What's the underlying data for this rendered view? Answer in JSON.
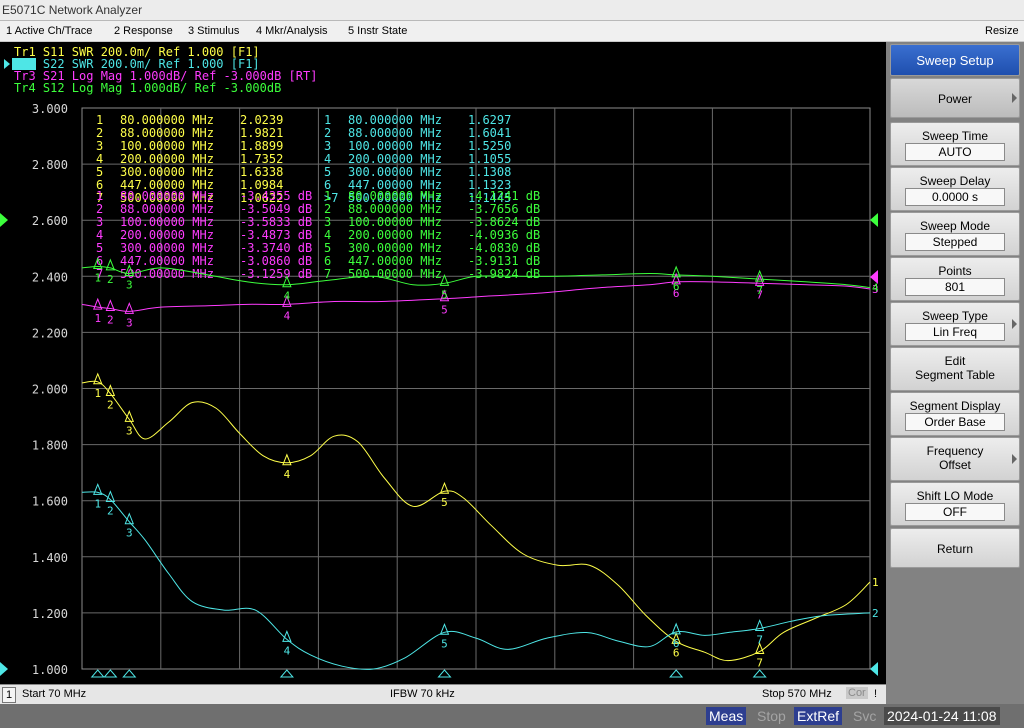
{
  "window": {
    "title": "E5071C Network Analyzer",
    "resize_label": "Resize"
  },
  "menu": [
    "1 Active Ch/Trace",
    "2 Response",
    "3 Stimulus",
    "4 Mkr/Analysis",
    "5 Instr State"
  ],
  "traces": [
    {
      "label": "Tr1 S11 SWR 200.0m/ Ref 1.000 [F1]",
      "color": "#ffff4a"
    },
    {
      "label": "Tr2 S22 SWR 200.0m/ Ref 1.000 [F1]",
      "color": "#4ee6e6"
    },
    {
      "label": "Tr3 S21 Log Mag 1.000dB/ Ref -3.000dB [RT]",
      "color": "#ff3cff"
    },
    {
      "label": "Tr4 S12 Log Mag 1.000dB/ Ref -3.000dB",
      "color": "#3cff3c"
    }
  ],
  "axis": {
    "y_ticks": [
      "3.000",
      "2.800",
      "2.600",
      "2.400",
      "2.200",
      "2.000",
      "1.800",
      "1.600",
      "1.400",
      "1.200",
      "1.000"
    ],
    "ylim": [
      1.0,
      3.0
    ],
    "xlim_mhz": [
      70,
      570
    ]
  },
  "marker_tables": {
    "tr1": [
      {
        "n": "1",
        "freq": "80.000000 MHz",
        "val": "2.0239"
      },
      {
        "n": "2",
        "freq": "88.000000 MHz",
        "val": "1.9821"
      },
      {
        "n": "3",
        "freq": "100.00000 MHz",
        "val": "1.8899"
      },
      {
        "n": "4",
        "freq": "200.00000 MHz",
        "val": "1.7352"
      },
      {
        "n": "5",
        "freq": "300.00000 MHz",
        "val": "1.6338"
      },
      {
        "n": "6",
        "freq": "447.00000 MHz",
        "val": "1.0984"
      },
      {
        "n": "7",
        "freq": "500.00000 MHz",
        "val": "1.0622"
      }
    ],
    "tr2": [
      {
        "n": "1",
        "freq": "80.000000 MHz",
        "val": "1.6297"
      },
      {
        "n": "2",
        "freq": "88.000000 MHz",
        "val": "1.6041"
      },
      {
        "n": "3",
        "freq": "100.00000 MHz",
        "val": "1.5250"
      },
      {
        "n": "4",
        "freq": "200.00000 MHz",
        "val": "1.1055"
      },
      {
        "n": "5",
        "freq": "300.00000 MHz",
        "val": "1.1308"
      },
      {
        "n": "6",
        "freq": "447.00000 MHz",
        "val": "1.1323"
      },
      {
        "n": ">7",
        "freq": "500.00000 MHz",
        "val": "1.1445"
      }
    ],
    "tr3": [
      {
        "n": "1",
        "freq": "80.000000 MHz",
        "val": "-3.4355 dB"
      },
      {
        "n": "2",
        "freq": "88.000000 MHz",
        "val": "-3.5049 dB"
      },
      {
        "n": "3",
        "freq": "100.00000 MHz",
        "val": "-3.5833 dB"
      },
      {
        "n": "4",
        "freq": "200.00000 MHz",
        "val": "-3.4873 dB"
      },
      {
        "n": "5",
        "freq": "300.00000 MHz",
        "val": "-3.3740 dB"
      },
      {
        "n": "6",
        "freq": "447.00000 MHz",
        "val": "-3.0860 dB"
      },
      {
        "n": "7",
        "freq": "500.00000 MHz",
        "val": "-3.1259 dB"
      }
    ],
    "tr4": [
      {
        "n": "1",
        "freq": "80.000000 MHz",
        "val": "-4.1241 dB"
      },
      {
        "n": "2",
        "freq": "88.000000 MHz",
        "val": "-3.7656 dB"
      },
      {
        "n": "3",
        "freq": "100.00000 MHz",
        "val": "-3.8624 dB"
      },
      {
        "n": "4",
        "freq": "200.00000 MHz",
        "val": "-4.0936 dB"
      },
      {
        "n": "5",
        "freq": "300.00000 MHz",
        "val": "-4.0830 dB"
      },
      {
        "n": "6",
        "freq": "447.00000 MHz",
        "val": "-3.9131 dB"
      },
      {
        "n": "7",
        "freq": "500.00000 MHz",
        "val": "-3.9824 dB"
      }
    ]
  },
  "chart_data": {
    "type": "line",
    "ylim": [
      1.0,
      3.0
    ],
    "xlim": [
      70,
      570
    ],
    "series": [
      {
        "name": "Tr1 S11",
        "color": "#ffff4a",
        "points": [
          [
            70,
            2.02
          ],
          [
            80,
            2.0239
          ],
          [
            88,
            1.9821
          ],
          [
            100,
            1.8899
          ],
          [
            110,
            1.82
          ],
          [
            125,
            1.88
          ],
          [
            140,
            1.95
          ],
          [
            155,
            1.93
          ],
          [
            170,
            1.84
          ],
          [
            185,
            1.76
          ],
          [
            200,
            1.7352
          ],
          [
            215,
            1.76
          ],
          [
            230,
            1.83
          ],
          [
            245,
            1.81
          ],
          [
            262,
            1.68
          ],
          [
            280,
            1.58
          ],
          [
            300,
            1.6338
          ],
          [
            312,
            1.61
          ],
          [
            330,
            1.51
          ],
          [
            350,
            1.41
          ],
          [
            372,
            1.37
          ],
          [
            392,
            1.37
          ],
          [
            410,
            1.3
          ],
          [
            428,
            1.19
          ],
          [
            447,
            1.0984
          ],
          [
            465,
            1.06
          ],
          [
            480,
            1.03
          ],
          [
            500,
            1.0622
          ],
          [
            515,
            1.13
          ],
          [
            535,
            1.18
          ],
          [
            555,
            1.23
          ],
          [
            570,
            1.31
          ]
        ]
      },
      {
        "name": "Tr2 S22",
        "color": "#4ee6e6",
        "points": [
          [
            70,
            1.63
          ],
          [
            80,
            1.6297
          ],
          [
            88,
            1.6041
          ],
          [
            100,
            1.525
          ],
          [
            110,
            1.46
          ],
          [
            125,
            1.34
          ],
          [
            140,
            1.24
          ],
          [
            160,
            1.21
          ],
          [
            180,
            1.21
          ],
          [
            200,
            1.1055
          ],
          [
            215,
            1.05
          ],
          [
            235,
            1.01
          ],
          [
            255,
            1.0
          ],
          [
            275,
            1.04
          ],
          [
            300,
            1.1308
          ],
          [
            320,
            1.11
          ],
          [
            340,
            1.07
          ],
          [
            365,
            1.11
          ],
          [
            390,
            1.13
          ],
          [
            410,
            1.1
          ],
          [
            430,
            1.08
          ],
          [
            447,
            1.1323
          ],
          [
            465,
            1.12
          ],
          [
            480,
            1.13
          ],
          [
            500,
            1.1445
          ],
          [
            520,
            1.17
          ],
          [
            540,
            1.19
          ],
          [
            570,
            1.2
          ]
        ]
      },
      {
        "name": "Tr3 S21",
        "color": "#ff3cff",
        "points": [
          [
            70,
            2.3
          ],
          [
            80,
            2.29
          ],
          [
            88,
            2.285
          ],
          [
            100,
            2.275
          ],
          [
            120,
            2.29
          ],
          [
            150,
            2.295
          ],
          [
            175,
            2.3
          ],
          [
            200,
            2.3
          ],
          [
            230,
            2.31
          ],
          [
            260,
            2.31
          ],
          [
            300,
            2.32
          ],
          [
            330,
            2.33
          ],
          [
            360,
            2.34
          ],
          [
            400,
            2.36
          ],
          [
            430,
            2.37
          ],
          [
            447,
            2.38
          ],
          [
            470,
            2.38
          ],
          [
            500,
            2.375
          ],
          [
            530,
            2.37
          ],
          [
            555,
            2.365
          ],
          [
            570,
            2.355
          ]
        ]
      },
      {
        "name": "Tr4 S12",
        "color": "#3cff3c",
        "points": [
          [
            70,
            2.43
          ],
          [
            80,
            2.435
          ],
          [
            88,
            2.43
          ],
          [
            100,
            2.41
          ],
          [
            120,
            2.43
          ],
          [
            145,
            2.41
          ],
          [
            175,
            2.38
          ],
          [
            200,
            2.37
          ],
          [
            225,
            2.385
          ],
          [
            255,
            2.4
          ],
          [
            280,
            2.37
          ],
          [
            300,
            2.375
          ],
          [
            320,
            2.4
          ],
          [
            345,
            2.4
          ],
          [
            370,
            2.4
          ],
          [
            400,
            2.405
          ],
          [
            430,
            2.41
          ],
          [
            447,
            2.405
          ],
          [
            470,
            2.4
          ],
          [
            500,
            2.39
          ],
          [
            530,
            2.38
          ],
          [
            555,
            2.37
          ],
          [
            570,
            2.36
          ]
        ]
      }
    ]
  },
  "status": {
    "ch": "1",
    "start": "Start 70 MHz",
    "ifbw": "IFBW 70 kHz",
    "stop": "Stop 570 MHz",
    "cor": "Cor",
    "excl": "!"
  },
  "bottom": {
    "meas": "Meas",
    "stop": "Stop",
    "extref": "ExtRef",
    "svc": "Svc",
    "datetime": "2024-01-24 11:08"
  },
  "softkeys": {
    "title": "Sweep Setup",
    "power": "Power",
    "sweep_time": {
      "label": "Sweep Time",
      "value": "AUTO"
    },
    "sweep_delay": {
      "label": "Sweep Delay",
      "value": "0.0000 s"
    },
    "sweep_mode": {
      "label": "Sweep Mode",
      "value": "Stepped"
    },
    "points": {
      "label": "Points",
      "value": "801"
    },
    "sweep_type": {
      "label": "Sweep Type",
      "value": "Lin Freq"
    },
    "edit_segment": {
      "label1": "Edit",
      "label2": "Segment Table"
    },
    "segment_display": {
      "label": "Segment Display",
      "value": "Order Base"
    },
    "frequency_offset": {
      "label1": "Frequency",
      "label2": "Offset"
    },
    "shift_lo": {
      "label": "Shift LO Mode",
      "value": "OFF"
    },
    "return": "Return"
  }
}
